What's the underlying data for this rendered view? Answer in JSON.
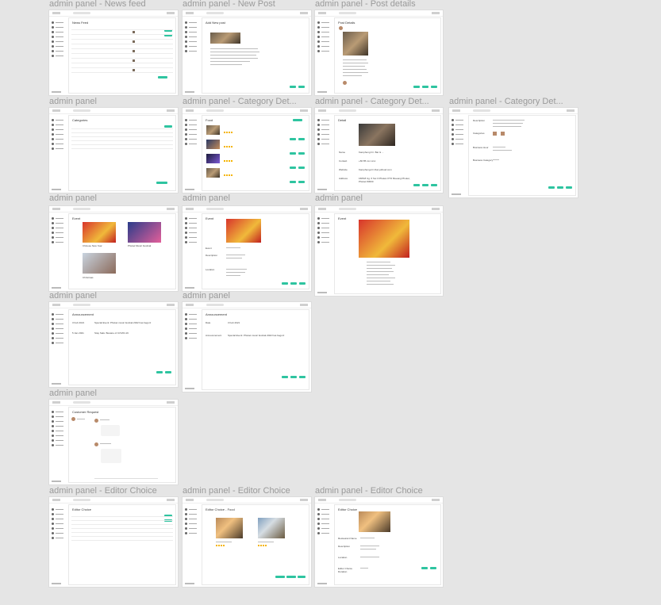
{
  "canvas": {
    "frames": [
      {
        "name": "admin panel - News feed"
      },
      {
        "name": "admin panel - New Post"
      },
      {
        "name": "admin panel - Post details"
      },
      {
        "name": "admin panel"
      },
      {
        "name": "admin panel - Category Det..."
      },
      {
        "name": "admin panel - Category Det..."
      },
      {
        "name": "admin panel - Category Det..."
      },
      {
        "name": "admin panel"
      },
      {
        "name": "admin panel"
      },
      {
        "name": "admin panel"
      },
      {
        "name": "admin panel"
      },
      {
        "name": "admin panel"
      },
      {
        "name": "admin panel"
      },
      {
        "name": "admin panel - Editor Choice"
      },
      {
        "name": "admin panel - Editor Choice"
      },
      {
        "name": "admin panel - Editor Choice"
      }
    ]
  },
  "screens": {
    "news_feed_title": "News Feed",
    "new_post_title": "Add New post",
    "post_details_title": "Post Details",
    "category_title": "Categories",
    "food_title": "Food",
    "detail_title": "Detail",
    "event_title": "Event",
    "announcement_title": "Announcement",
    "customer_request_title": "Customer Request",
    "editor_choice_title": "Editor Choice",
    "editor_choice_food_title": "Editor Choice - Food",
    "event_items": [
      "Chinese New Year",
      "Phuket Music Festival",
      "Christmas"
    ],
    "announcement_dates": [
      "3 Feb 2021",
      "5 Jan 2021"
    ],
    "announcement_texts": [
      "Special Event: Phuket music festival 2022 has begun!",
      "Stay Safe: Beware of COVID-19"
    ],
    "detail_labels": [
      "Name",
      "Contact",
      "Website",
      "Address"
    ],
    "detail_values": [
      "Kampheng Irrr. Bar & ...",
      "+66 85 xxx xxxx",
      "Kampheng-irrr.thai.yolfood.com",
      "168/18 Ug. 6 Soi 3 Phuket-VTD Mueang Phuket, Phuket 83000"
    ],
    "desc_labels": [
      "Description",
      "Categories",
      "Business Hour",
      "Business Category"
    ],
    "event_detail_labels": [
      "Event",
      "Description",
      "Location"
    ],
    "ann_detail_labels": [
      "Date",
      "Announcement"
    ],
    "ann_detail_values": [
      "3 Feb 2021",
      "Special Event: Phuket music festival 2022 has begun!"
    ],
    "ec_detail_labels": [
      "Restaurant Name",
      "Description",
      "Location",
      "Editor Choice Duration"
    ]
  },
  "colors": {
    "accent": "#2ec4a0",
    "canvas": "#e5e5e5",
    "label": "#9a9a9a"
  }
}
